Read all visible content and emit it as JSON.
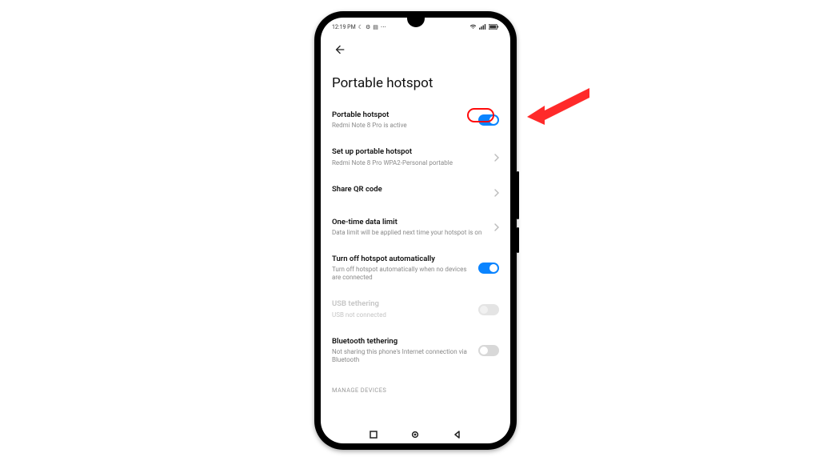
{
  "statusbar": {
    "time": "12:19 PM",
    "iconsLeft": [
      "moon-icon",
      "gear-icon",
      "calendar-icon",
      "dots-icon"
    ],
    "iconsRight": [
      "wifi-icon",
      "signal-icon",
      "battery-icon"
    ]
  },
  "header": {
    "back": "←"
  },
  "pageTitle": "Portable hotspot",
  "rows": {
    "hotspot": {
      "title": "Portable hotspot",
      "sub": "Redmi Note 8 Pro is active",
      "toggleOn": true
    },
    "setup": {
      "title": "Set up portable hotspot",
      "sub": "Redmi Note 8 Pro WPA2-Personal portable"
    },
    "qr": {
      "title": "Share QR code"
    },
    "limit": {
      "title": "One-time data limit",
      "sub": "Data limit will be applied next time your hotspot is on"
    },
    "autooff": {
      "title": "Turn off hotspot automatically",
      "sub": "Turn off hotspot automatically when no devices are connected",
      "toggleOn": true
    },
    "usb": {
      "title": "USB tethering",
      "sub": "USB not connected",
      "toggleOn": false
    },
    "bt": {
      "title": "Bluetooth tethering",
      "sub": "Not sharing this phone's Internet connection via Bluetooth",
      "toggleOn": false
    }
  },
  "sectionLabel": "MANAGE DEVICES",
  "annotation": {
    "arrowColor": "#ff2a2a",
    "highlightColor": "#ff0a0a"
  }
}
